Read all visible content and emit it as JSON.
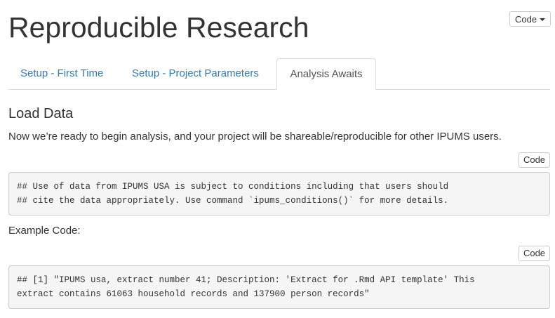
{
  "header": {
    "title": "Reproducible Research",
    "code_menu_label": "Code"
  },
  "tabs": [
    {
      "label": "Setup - First Time",
      "active": false
    },
    {
      "label": "Setup - Project Parameters",
      "active": false
    },
    {
      "label": "Analysis Awaits",
      "active": true
    }
  ],
  "section": {
    "title": "Load Data",
    "intro": "Now we’re ready to begin analysis, and your project will be shareable/reproducible for other IPUMS users."
  },
  "code_blocks": [
    {
      "button_label": "Code",
      "lines": [
        "## Use of data from IPUMS USA is subject to conditions including that users should",
        "## cite the data appropriately. Use command `ipums_conditions()` for more details."
      ]
    },
    {
      "button_label": "Code",
      "lines": [
        "## [1] \"IPUMS usa, extract number 41; Description: 'Extract for .Rmd API template' This",
        "extract contains 61063 household records and 137900 person records\""
      ]
    }
  ],
  "example_label": "Example Code:",
  "colors": {
    "link": "#337ab7",
    "text": "#333333",
    "code_bg": "#f5f5f5",
    "border": "#cccccc"
  }
}
